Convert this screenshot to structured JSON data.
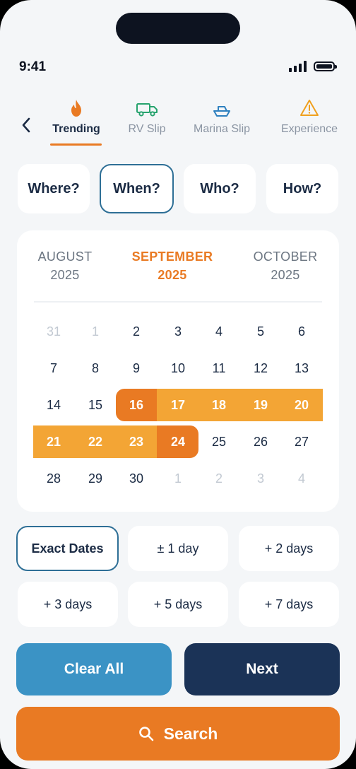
{
  "status": {
    "time": "9:41"
  },
  "tabs": [
    {
      "label": "Trending",
      "icon": "flame-icon"
    },
    {
      "label": "RV Slip",
      "icon": "truck-icon"
    },
    {
      "label": "Marina Slip",
      "icon": "boat-icon"
    },
    {
      "label": "Experience",
      "icon": "warning-icon"
    }
  ],
  "segments": [
    "Where?",
    "When?",
    "Who?",
    "How?"
  ],
  "calendar": {
    "months": [
      {
        "name": "AUGUST",
        "year": "2025"
      },
      {
        "name": "SEPTEMBER",
        "year": "2025"
      },
      {
        "name": "OCTOBER",
        "year": "2025"
      }
    ],
    "weeks": [
      [
        "31",
        "1",
        "2",
        "3",
        "4",
        "5",
        "6"
      ],
      [
        "7",
        "8",
        "9",
        "10",
        "11",
        "12",
        "13"
      ],
      [
        "14",
        "15",
        "16",
        "17",
        "18",
        "19",
        "20"
      ],
      [
        "21",
        "22",
        "23",
        "24",
        "25",
        "26",
        "27"
      ],
      [
        "28",
        "29",
        "30",
        "1",
        "2",
        "3",
        "4"
      ]
    ],
    "range_start": "16",
    "range_end": "24"
  },
  "flex_options": [
    "Exact Dates",
    "± 1 day",
    "+ 2 days",
    "+ 3 days",
    "+ 5 days",
    "+ 7 days"
  ],
  "actions": {
    "clear": "Clear All",
    "next": "Next",
    "search": "Search"
  },
  "colors": {
    "accent": "#e97a23",
    "range": "#f3a535",
    "navy": "#1b3357",
    "blue": "#3b93c5",
    "outline": "#2e6f96"
  }
}
